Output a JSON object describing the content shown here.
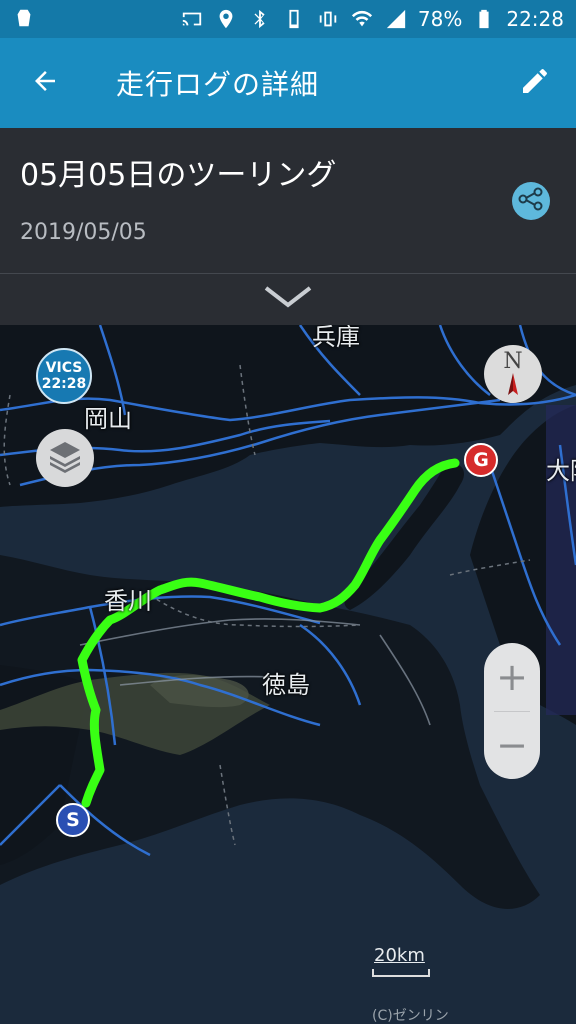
{
  "status_bar": {
    "battery": "78%",
    "time": "22:28",
    "icons": [
      "notification-icon",
      "cast-icon",
      "location-icon",
      "bluetooth-icon",
      "phone-icon",
      "vibrate-icon",
      "wifi-icon",
      "signal-icon",
      "battery-icon"
    ]
  },
  "appbar": {
    "title": "走行ログの詳細",
    "back_icon": "arrow-left-icon",
    "edit_icon": "pencil-icon"
  },
  "log": {
    "title": "05月05日のツーリング",
    "date": "2019/05/05",
    "share_icon": "share-icon",
    "collapse_icon": "chevron-down-icon"
  },
  "map": {
    "vics": {
      "label": "VICS",
      "time": "22:28"
    },
    "labels": {
      "hyogo": "兵庫",
      "okayama": "岡山",
      "kagawa": "香川",
      "tokushima": "徳島",
      "osaka": "大阪"
    },
    "markers": {
      "goal": "G",
      "start": "S"
    },
    "zoom": {
      "plus": "+",
      "minus": "−"
    },
    "compass": "N",
    "scale": "20km",
    "copyright": "(C)ゼンリン",
    "colors": {
      "route": "#39ff14",
      "water": "#1b2a3c",
      "land": "#10161d",
      "road": "#2f6fd0"
    }
  }
}
